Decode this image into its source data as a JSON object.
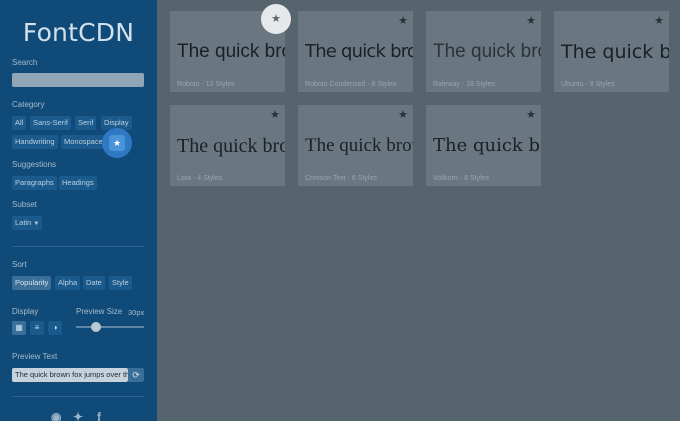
{
  "app": {
    "title": "FontCDN"
  },
  "sidebar": {
    "search_label": "Search",
    "search_placeholder": "",
    "category_label": "Category",
    "categories": [
      "All",
      "Sans-Serif",
      "Serif",
      "Display",
      "Handwriting",
      "Monospace"
    ],
    "favorites_icon": "star-icon",
    "suggestions_label": "Suggestions",
    "suggestions": [
      "Paragraphs",
      "Headings"
    ],
    "subset_label": "Subset",
    "subset_value": "Latin",
    "sort_label": "Sort",
    "sort_options": [
      "Popularity",
      "Alpha",
      "Date",
      "Style"
    ],
    "display_label": "Display",
    "display_icons": [
      "grid-icon",
      "list-icon",
      "contrast-icon"
    ],
    "preview_size_label": "Preview Size",
    "preview_size_value": "30px",
    "preview_size_fraction": 0.3,
    "preview_text_label": "Preview Text",
    "preview_text_value": "The quick brown fox jumps over the lazy dog",
    "social_icons": [
      "github-icon",
      "twitter-icon",
      "facebook-icon"
    ]
  },
  "fonts": [
    {
      "sample": "The quick brown fox",
      "meta": "Roboto - 12 Styles"
    },
    {
      "sample": "The quick brown fox",
      "meta": "Roboto Condensed - 6 Styles"
    },
    {
      "sample": "The quick brown fox",
      "meta": "Raleway - 18 Styles"
    },
    {
      "sample": "The quick brown fox",
      "meta": "Ubuntu - 8 Styles"
    },
    {
      "sample": "The quick brown fox",
      "meta": "Lora - 4 Styles"
    },
    {
      "sample": "The quick brown fox",
      "meta": "Crimson Text - 6 Styles"
    },
    {
      "sample": "The quick brown fox",
      "meta": "Vollkorn - 8 Styles"
    }
  ],
  "colors": {
    "sidebar": "#0f4a78",
    "main": "#56646e",
    "accent": "#4a93d8"
  }
}
